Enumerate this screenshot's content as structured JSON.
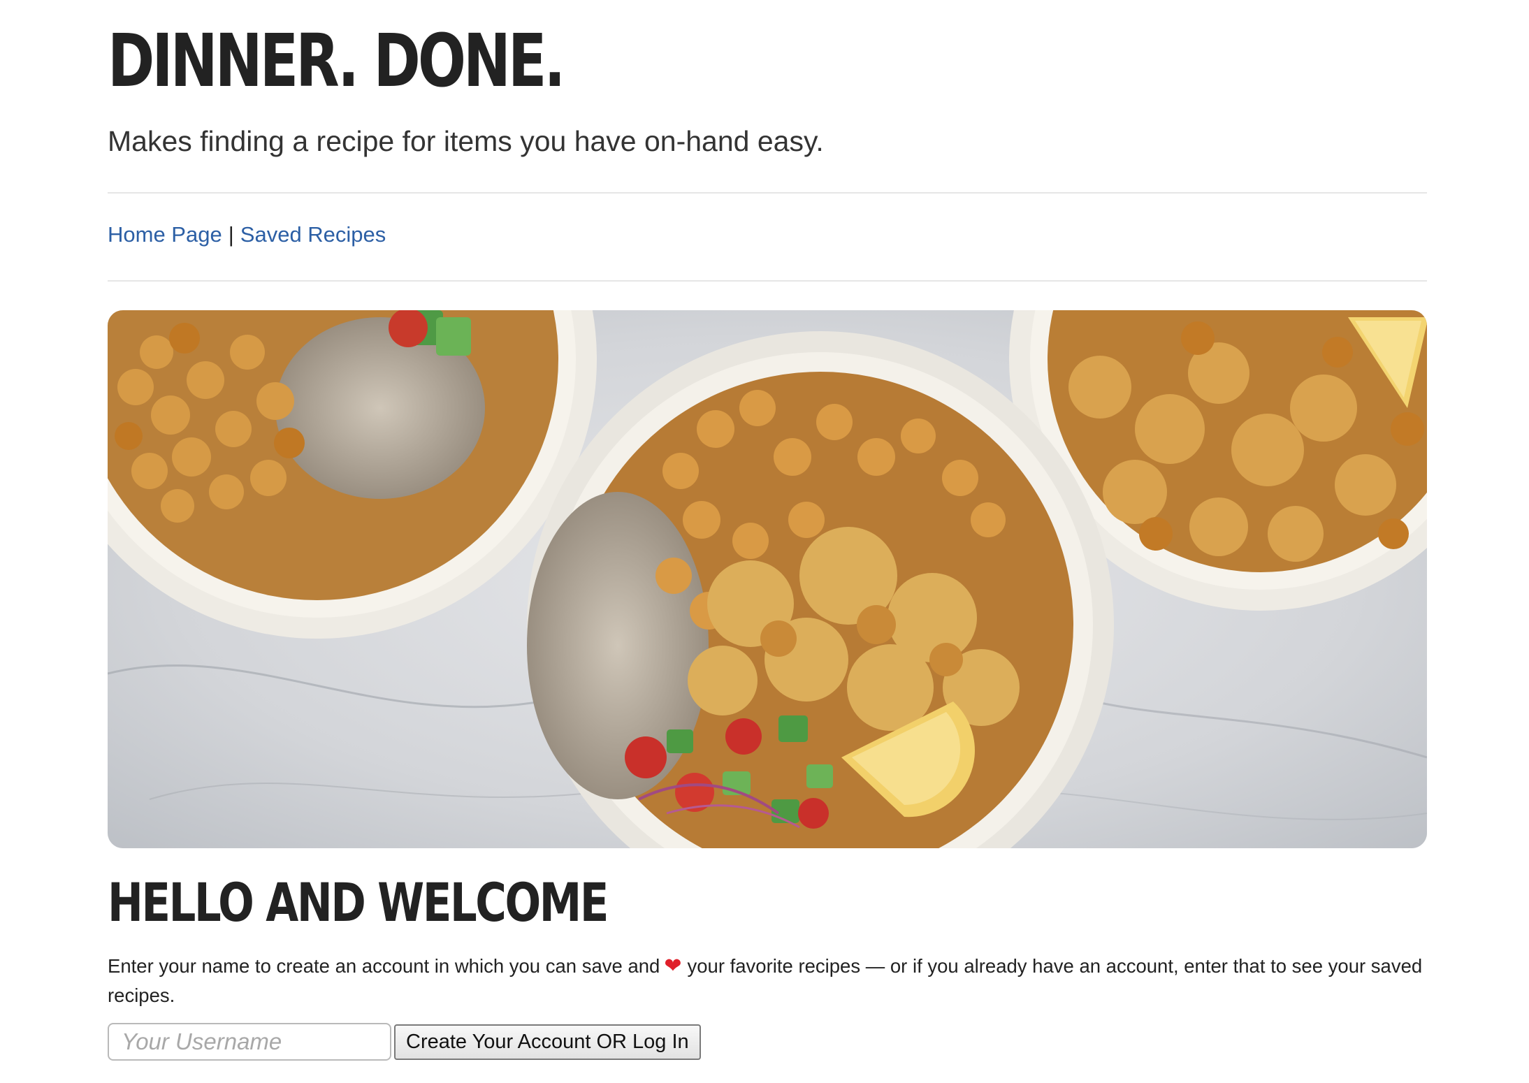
{
  "header": {
    "title": "DINNER. DONE.",
    "tagline": "Makes finding a recipe for items you have on-hand easy."
  },
  "nav": {
    "items": [
      {
        "label": "Home Page"
      },
      {
        "label": "Saved Recipes"
      }
    ],
    "separator": "|"
  },
  "hero": {
    "icon": "food-bowls-photo"
  },
  "welcome": {
    "heading": "HELLO AND WELCOME",
    "intro_before": "Enter your name to create an account in which you can save and",
    "heart_icon": "❤",
    "intro_after": "your favorite recipes — or if you already have an account, enter that to see your saved recipes."
  },
  "login": {
    "placeholder": "Your Username",
    "value": "",
    "button_label": "Create Your Account OR Log In"
  },
  "colors": {
    "link": "#2c5fa5",
    "heart": "#e0202a",
    "text": "#222222"
  }
}
